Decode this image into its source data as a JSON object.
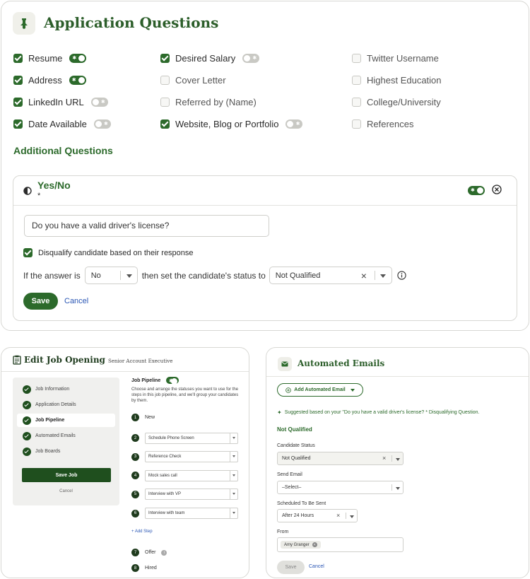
{
  "application_questions": {
    "title": "Application Questions",
    "icon": "pin-icon",
    "columns": [
      [
        {
          "label": "Resume",
          "checked": true,
          "required_toggle": true,
          "required": true
        },
        {
          "label": "Address",
          "checked": true,
          "required_toggle": true,
          "required": true
        },
        {
          "label": "LinkedIn URL",
          "checked": true,
          "required_toggle": true,
          "required": false
        },
        {
          "label": "Date Available",
          "checked": true,
          "required_toggle": true,
          "required": false
        }
      ],
      [
        {
          "label": "Desired Salary",
          "checked": true,
          "required_toggle": true,
          "required": false
        },
        {
          "label": "Cover Letter",
          "checked": false,
          "required_toggle": false
        },
        {
          "label": "Referred by (Name)",
          "checked": false,
          "required_toggle": false
        },
        {
          "label": "Website, Blog or Portfolio",
          "checked": true,
          "required_toggle": true,
          "required": false
        }
      ],
      [
        {
          "label": "Twitter Username",
          "checked": false,
          "required_toggle": false
        },
        {
          "label": "Highest Education",
          "checked": false,
          "required_toggle": false
        },
        {
          "label": "College/University",
          "checked": false,
          "required_toggle": false
        },
        {
          "label": "References",
          "checked": false,
          "required_toggle": false
        }
      ]
    ]
  },
  "additional_questions": {
    "heading": "Additional Questions",
    "yes_no": {
      "title": "Yes/No",
      "required_marker": "*",
      "required": true,
      "question_value": "Do you have a valid driver's license?",
      "disqualify_label": "Disqualify candidate based on their response",
      "disqualify_checked": true,
      "rule_prefix": "If the answer is",
      "answer_value": "No",
      "rule_middle": "then set the candidate's status to",
      "status_value": "Not Qualified",
      "save_label": "Save",
      "cancel_label": "Cancel"
    }
  },
  "job_opening": {
    "title": "Edit Job Opening",
    "subtitle": "Senior Account Executive",
    "steps": [
      {
        "label": "Job Information",
        "active": false
      },
      {
        "label": "Application Details",
        "active": false
      },
      {
        "label": "Job Pipeline",
        "active": true
      },
      {
        "label": "Automated Emails",
        "active": false
      },
      {
        "label": "Job Boards",
        "active": false
      }
    ],
    "save_label": "Save Job",
    "cancel_label": "Cancel",
    "pipeline": {
      "label": "Job Pipeline",
      "enabled": true,
      "description": "Choose and arrange the statuses you want to use for the steps in this job pipeline, and we'll group your candidates by them.",
      "rows": [
        {
          "num": "1",
          "text": "New",
          "select": false
        },
        {
          "num": "2",
          "text": "Schedule Phone Screen",
          "select": true
        },
        {
          "num": "3",
          "text": "Reference Check",
          "select": true
        },
        {
          "num": "4",
          "text": "Mock sales call",
          "select": true
        },
        {
          "num": "5",
          "text": "Interview with VP",
          "select": true
        },
        {
          "num": "6",
          "text": "Interview with team",
          "select": true
        }
      ],
      "add_step_label": "+ Add Step",
      "final_rows": [
        {
          "num": "7",
          "text": "Offer",
          "info": true
        },
        {
          "num": "8",
          "text": "Hired",
          "info": false
        }
      ]
    }
  },
  "automated_emails": {
    "title": "Automated Emails",
    "add_button_label": "Add Automated Email",
    "suggestion": "Suggested based on your \"Do you have a valid driver's license? * Disqualifying Question.",
    "section_heading": "Not Qualified",
    "candidate_status_label": "Candidate Status",
    "candidate_status_value": "Not Qualified",
    "send_email_label": "Send Email",
    "send_email_value": "–Select–",
    "scheduled_label": "Scheduled To Be Sent",
    "scheduled_value": "After 24 Hours",
    "from_label": "From",
    "from_chip": "Amy Granger",
    "save_label": "Save",
    "cancel_label": "Cancel"
  },
  "colors": {
    "brand_green": "#2c6a2b",
    "dark_green": "#1f4f1e",
    "link_blue": "#2a56b4"
  }
}
